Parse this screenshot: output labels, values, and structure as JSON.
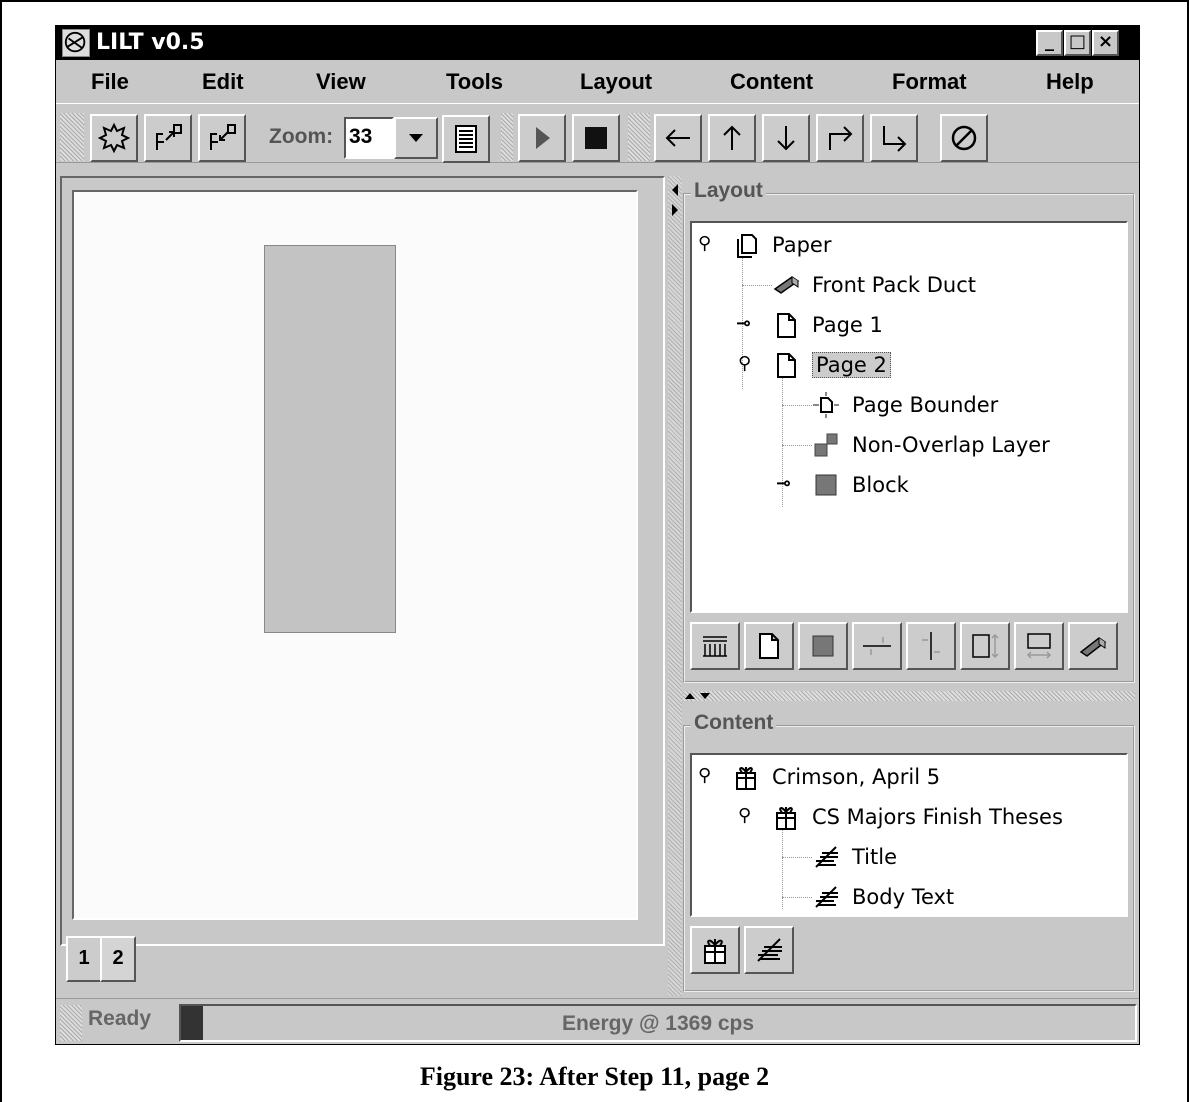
{
  "window": {
    "title": "LILT v0.5",
    "controls": {
      "minimize": "_",
      "maximize": "□",
      "close": "×"
    }
  },
  "menubar": [
    "File",
    "Edit",
    "View",
    "Tools",
    "Layout",
    "Content",
    "Format",
    "Help"
  ],
  "toolbar": {
    "zoom_label": "Zoom:",
    "zoom_value": "33"
  },
  "page_tabs": [
    "1",
    "2"
  ],
  "layout_panel": {
    "label": "Layout",
    "tree": [
      "Paper",
      "Front Pack Duct",
      "Page 1",
      "Page 2",
      "Page Bounder",
      "Non-Overlap Layer",
      "Block"
    ]
  },
  "content_panel": {
    "label": "Content",
    "tree": [
      "Crimson, April 5",
      "CS Majors Finish Theses",
      "Title",
      "Body Text"
    ]
  },
  "status": {
    "ready": "Ready",
    "energy": "Energy @ 1369 cps"
  },
  "caption": "Figure 23: After Step 11, page 2"
}
